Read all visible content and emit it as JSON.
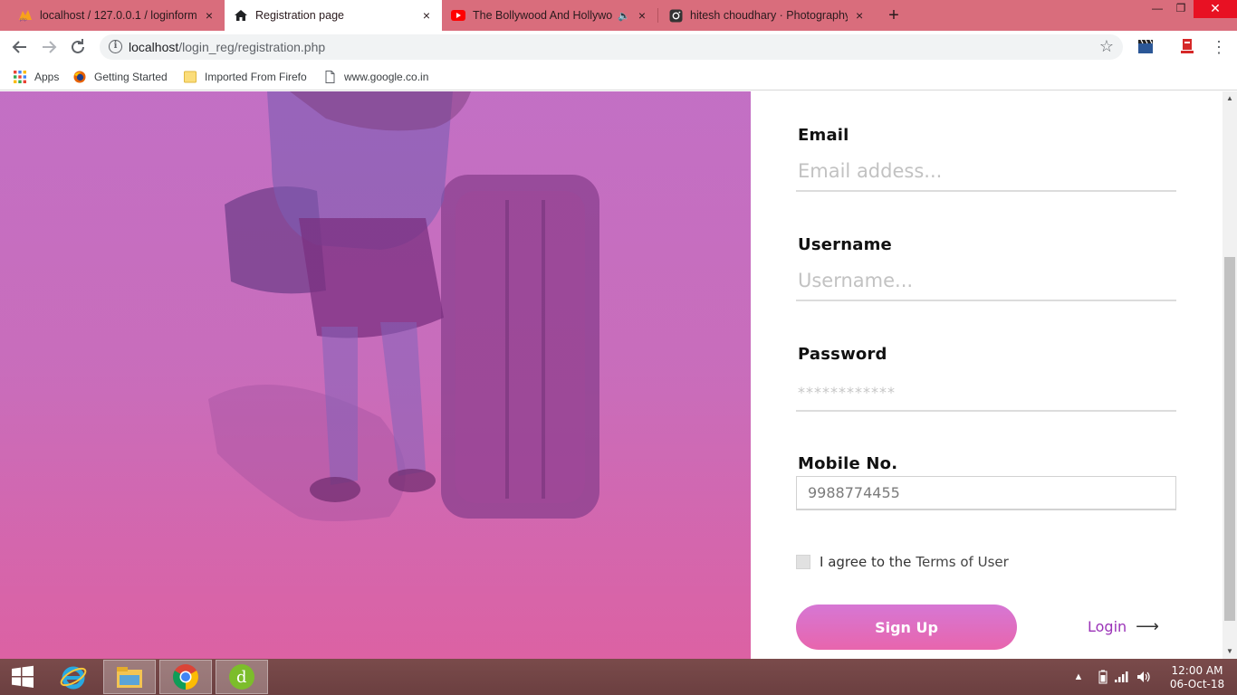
{
  "browser": {
    "tabs": [
      {
        "title": "localhost / 127.0.0.1 / loginform",
        "icon": "phpmyadmin-icon"
      },
      {
        "title": "Registration page",
        "icon": "home-icon"
      },
      {
        "title": "The Bollywood And Hollywo",
        "icon": "youtube-icon"
      },
      {
        "title": "hitesh choudhary · Photography",
        "icon": "instagram-icon"
      }
    ],
    "tab_close": "×",
    "new_tab": "+",
    "url_host": "localhost",
    "url_path": "/login_reg/registration.php",
    "info_glyph": "i"
  },
  "bookmarks": [
    {
      "label": "Apps",
      "icon": "apps-grid-icon"
    },
    {
      "label": "Getting Started",
      "icon": "firefox-icon"
    },
    {
      "label": "Imported From Firefo",
      "icon": "folder-icon"
    },
    {
      "label": "www.google.co.in",
      "icon": "page-icon"
    }
  ],
  "form": {
    "email_label": "Email",
    "email_placeholder": "Email addess...",
    "username_label": "Username",
    "username_placeholder": "Username...",
    "password_label": "Password",
    "password_placeholder": "************",
    "mobile_label": "Mobile No.",
    "mobile_placeholder": "9988774455",
    "agree_text": "I agree to the",
    "terms_text": "Terms of User",
    "signup_label": "Sign Up",
    "login_label": "Login",
    "login_arrow": "⟶"
  },
  "taskbar": {
    "time": "12:00 AM",
    "date": "06-Oct-18"
  },
  "colors": {
    "tabstrip": "#d96d7c",
    "hero_top": "#c974c9",
    "hero_bottom": "#e365a6",
    "signup_button": "#e865ad",
    "login_link": "#9b33b8",
    "taskbar": "#6b3f40"
  }
}
